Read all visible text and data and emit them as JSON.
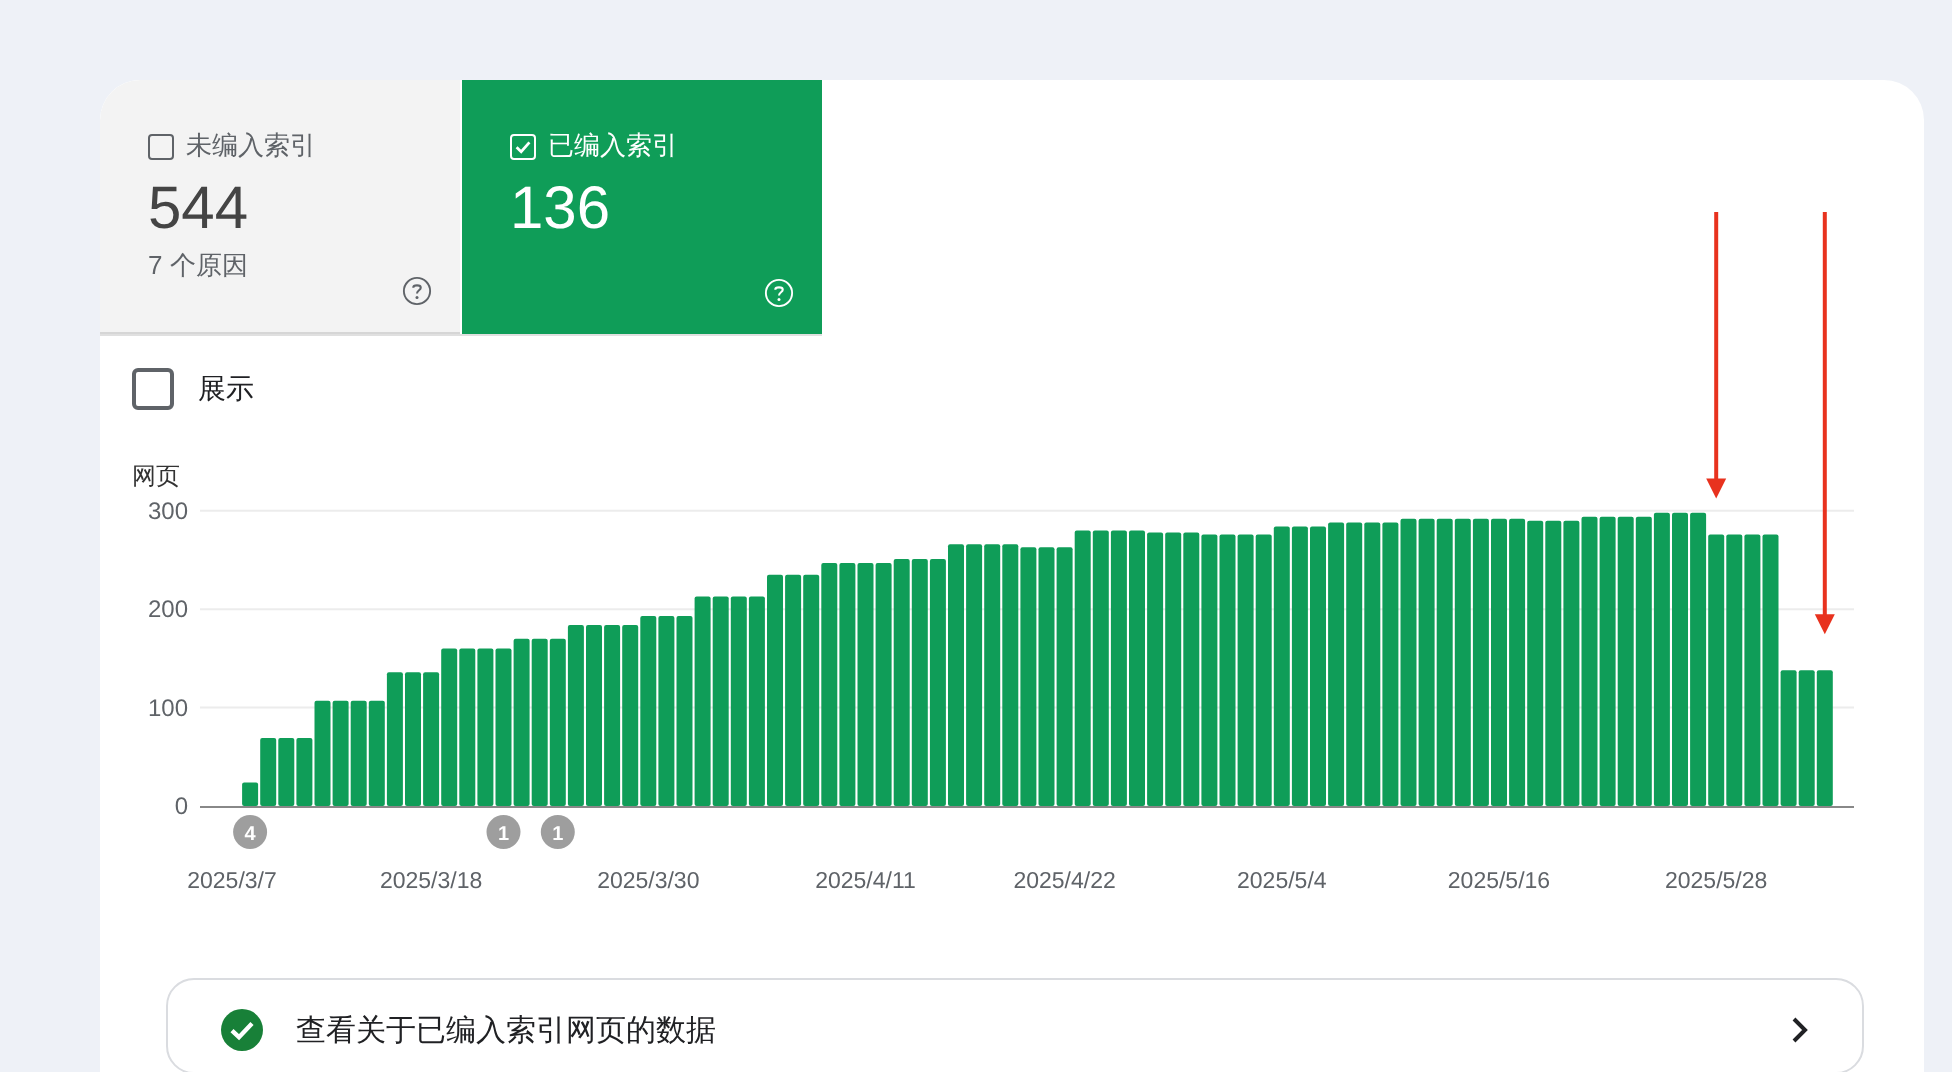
{
  "tabs": [
    {
      "label": "未编入索引",
      "count": "544",
      "subtitle": "7 个原因",
      "selected": false
    },
    {
      "label": "已编入索引",
      "count": "136",
      "selected": true
    }
  ],
  "show_toggle": {
    "label": "展示",
    "checked": false
  },
  "chart_data": {
    "type": "bar",
    "ylabel": "网页",
    "ylim": [
      0,
      300
    ],
    "yticks": [
      0,
      100,
      200,
      300
    ],
    "categories": [
      "2025/3/7",
      null,
      null,
      null,
      null,
      null,
      null,
      null,
      null,
      null,
      null,
      "2025/3/18",
      null,
      null,
      null,
      null,
      null,
      null,
      null,
      null,
      null,
      null,
      null,
      "2025/3/30",
      null,
      null,
      null,
      null,
      null,
      null,
      null,
      null,
      null,
      null,
      null,
      "2025/4/11",
      null,
      null,
      null,
      null,
      null,
      null,
      null,
      null,
      null,
      null,
      "2025/4/22",
      null,
      null,
      null,
      null,
      null,
      null,
      null,
      null,
      null,
      null,
      null,
      "2025/5/4",
      null,
      null,
      null,
      null,
      null,
      null,
      null,
      null,
      null,
      null,
      null,
      "2025/5/16",
      null,
      null,
      null,
      null,
      null,
      null,
      null,
      null,
      null,
      null,
      null,
      "2025/5/28",
      null,
      null,
      null,
      null,
      null,
      null
    ],
    "series": [
      {
        "color": "#0f9d58",
        "values": [
          null,
          24,
          69,
          69,
          69,
          107,
          107,
          107,
          107,
          136,
          136,
          136,
          160,
          160,
          160,
          160,
          170,
          170,
          170,
          184,
          184,
          184,
          184,
          193,
          193,
          193,
          213,
          213,
          213,
          213,
          235,
          235,
          235,
          247,
          247,
          247,
          247,
          251,
          251,
          251,
          266,
          266,
          266,
          266,
          263,
          263,
          263,
          280,
          280,
          280,
          280,
          278,
          278,
          278,
          276,
          276,
          276,
          276,
          284,
          284,
          284,
          288,
          288,
          288,
          288,
          292,
          292,
          292,
          292,
          292,
          292,
          292,
          290,
          290,
          290,
          294,
          294,
          294,
          294,
          298,
          298,
          298,
          276,
          276,
          276,
          276,
          138,
          138,
          138
        ]
      }
    ],
    "annotations": [
      "4",
      "1",
      "1"
    ]
  },
  "details_link": {
    "label": "查看关于已编入索引网页的数据"
  }
}
